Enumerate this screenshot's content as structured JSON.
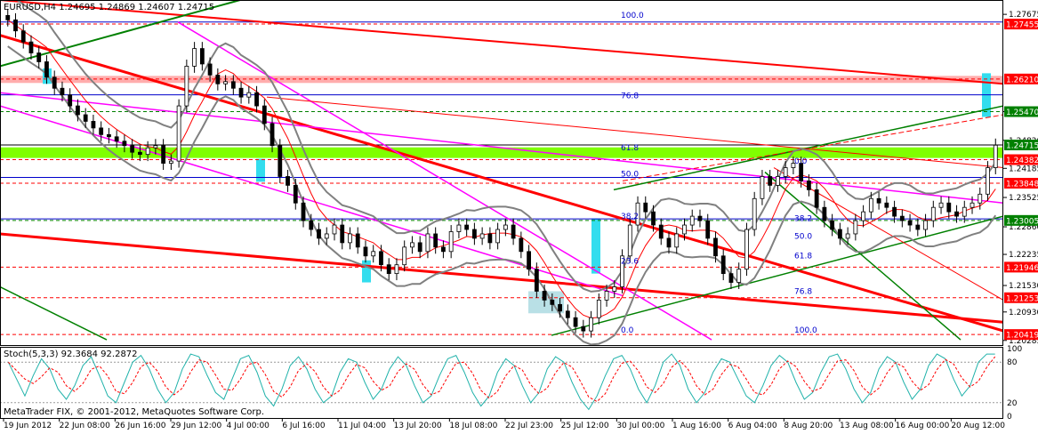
{
  "header": {
    "symbol_line": "EURUSD,H4  1.24695 1.24869 1.24607 1.24715"
  },
  "footer": {
    "copyright": "MetaTrader FIX, © 2001-2012, MetaQuotes Software Corp."
  },
  "stoch": {
    "label": "Stoch(5,3,3) 92.3684 92.2872",
    "axis_labels": [
      "100",
      "80",
      "20",
      "0"
    ],
    "axis_values": [
      100,
      80,
      20,
      0
    ]
  },
  "colors": {
    "candle": "#000000",
    "bollinger": "#808080",
    "ma": "#ff0000",
    "trend_red": "#ff0000",
    "channel_magenta": "#ff00ff",
    "channel_green": "#008000",
    "zone_green": "#80ff00",
    "zone_pink": "#ff9999",
    "zone_cyan": "#33ddee",
    "fib_blue": "#0000cc",
    "current_price_tag": "#008000"
  },
  "chart_data": {
    "type": "candlestick",
    "symbol": "EURUSD",
    "timeframe": "H4",
    "ohlc_last": {
      "open": 1.24695,
      "high": 1.24869,
      "low": 1.24607,
      "close": 1.24715
    },
    "ylim": [
      1.2018,
      1.28
    ],
    "price_ticks": [
      {
        "value": 1.27675,
        "label": "1.27675"
      },
      {
        "value": 1.2547,
        "label": "1.25470"
      },
      {
        "value": 1.2482,
        "label": "1.24820"
      },
      {
        "value": 1.24185,
        "label": "1.24185"
      },
      {
        "value": 1.23525,
        "label": "1.23525"
      },
      {
        "value": 1.2286,
        "label": "1.22860"
      },
      {
        "value": 1.22235,
        "label": "1.22235"
      },
      {
        "value": 1.2153,
        "label": "1.21530"
      },
      {
        "value": 1.2093,
        "label": "1.20930"
      },
      {
        "value": 1.20285,
        "label": "1.20285"
      }
    ],
    "price_tags": [
      {
        "value": 1.27455,
        "label": "1.27455",
        "kind": "red"
      },
      {
        "value": 1.2621,
        "label": "1.26210",
        "kind": "red"
      },
      {
        "value": 1.2547,
        "label": "1.25470",
        "kind": "green"
      },
      {
        "value": 1.24715,
        "label": "1.24715",
        "kind": "current"
      },
      {
        "value": 1.24382,
        "label": "1.24382",
        "kind": "red"
      },
      {
        "value": 1.23848,
        "label": "1.23848",
        "kind": "red"
      },
      {
        "value": 1.23005,
        "label": "1.23005",
        "kind": "green"
      },
      {
        "value": 1.21946,
        "label": "1.21946",
        "kind": "red"
      },
      {
        "value": 1.21253,
        "label": "1.21253",
        "kind": "red"
      },
      {
        "value": 1.20419,
        "label": "1.20419",
        "kind": "red"
      }
    ],
    "time_labels": [
      "19 Jun 2012",
      "22 Jun 08:00",
      "26 Jun 16:00",
      "29 Jun 12:00",
      "4 Jul 00:00",
      "6 Jul 16:00",
      "11 Jul 04:00",
      "13 Jul 20:00",
      "18 Jul 08:00",
      "22 Jul 23:00",
      "25 Jul 12:00",
      "30 Jul 00:00",
      "1 Aug 16:00",
      "6 Aug 04:00",
      "8 Aug 20:00",
      "13 Aug 08:00",
      "16 Aug 00:00",
      "20 Aug 12:00"
    ],
    "fib_levels_1": [
      {
        "label": "100.0",
        "value": 1.2756
      },
      {
        "label": "76.8",
        "value": 1.2573
      },
      {
        "label": "61.8",
        "value": 1.2455
      },
      {
        "label": "50.0",
        "value": 1.2396
      },
      {
        "label": "38.2",
        "value": 1.23
      },
      {
        "label": "23.6",
        "value": 1.2198
      },
      {
        "label": "0.0",
        "value": 1.2042
      }
    ],
    "fib_levels_2": [
      {
        "label": "0.0",
        "value": 1.2425
      },
      {
        "label": "38.2",
        "value": 1.2295
      },
      {
        "label": "50.0",
        "value": 1.2255
      },
      {
        "label": "61.8",
        "value": 1.221
      },
      {
        "label": "76.8",
        "value": 1.213
      },
      {
        "label": "100.0",
        "value": 1.2042
      }
    ],
    "close_path": [
      1.2755,
      1.273,
      1.2705,
      1.268,
      1.266,
      1.2625,
      1.26,
      1.2585,
      1.256,
      1.254,
      1.2525,
      1.251,
      1.2495,
      1.249,
      1.248,
      1.247,
      1.2455,
      1.245,
      1.2465,
      1.247,
      1.243,
      1.2435,
      1.256,
      1.265,
      1.269,
      1.2655,
      1.263,
      1.261,
      1.2615,
      1.26,
      1.258,
      1.259,
      1.256,
      1.252,
      1.247,
      1.24,
      1.238,
      1.234,
      1.23,
      1.228,
      1.226,
      1.227,
      1.229,
      1.225,
      1.227,
      1.224,
      1.222,
      1.223,
      1.22,
      1.218,
      1.22,
      1.224,
      1.225,
      1.223,
      1.227,
      1.224,
      1.223,
      1.2275,
      1.229,
      1.228,
      1.226,
      1.227,
      1.225,
      1.228,
      1.229,
      1.226,
      1.223,
      1.219,
      1.214,
      1.212,
      1.211,
      1.2095,
      1.208,
      1.206,
      1.205,
      1.208,
      1.212,
      1.214,
      1.215,
      1.222,
      1.229,
      1.234,
      1.232,
      1.229,
      1.226,
      1.224,
      1.227,
      1.229,
      1.231,
      1.23,
      1.226,
      1.222,
      1.218,
      1.216,
      1.219,
      1.228,
      1.235,
      1.24,
      1.238,
      1.24,
      1.242,
      1.243,
      1.239,
      1.237,
      1.233,
      1.23,
      1.228,
      1.226,
      1.227,
      1.23,
      1.232,
      1.235,
      1.234,
      1.233,
      1.231,
      1.23,
      1.229,
      1.228,
      1.23,
      1.233,
      1.234,
      1.232,
      1.231,
      1.233,
      1.234,
      1.236,
      1.242,
      1.2471
    ],
    "stoch_k": [
      80,
      55,
      30,
      60,
      85,
      70,
      40,
      25,
      45,
      75,
      88,
      60,
      30,
      20,
      50,
      80,
      90,
      70,
      40,
      20,
      35,
      70,
      92,
      88,
      60,
      35,
      25,
      55,
      85,
      90,
      65,
      30,
      15,
      40,
      75,
      88,
      70,
      40,
      20,
      30,
      65,
      85,
      80,
      50,
      25,
      40,
      70,
      88,
      75,
      45,
      20,
      30,
      60,
      85,
      90,
      65,
      35,
      15,
      30,
      65,
      85,
      75,
      45,
      20,
      35,
      70,
      88,
      80,
      50,
      25,
      10,
      30,
      60,
      85,
      90,
      70,
      40,
      20,
      45,
      80,
      92,
      75,
      40,
      20,
      35,
      65,
      85,
      80,
      55,
      30,
      20,
      45,
      75,
      90,
      80,
      50,
      25,
      35,
      65,
      88,
      92,
      70,
      40,
      20,
      35,
      70,
      88,
      80,
      50,
      25,
      40,
      75,
      92,
      85,
      55,
      30,
      45,
      80,
      92,
      92
    ]
  }
}
